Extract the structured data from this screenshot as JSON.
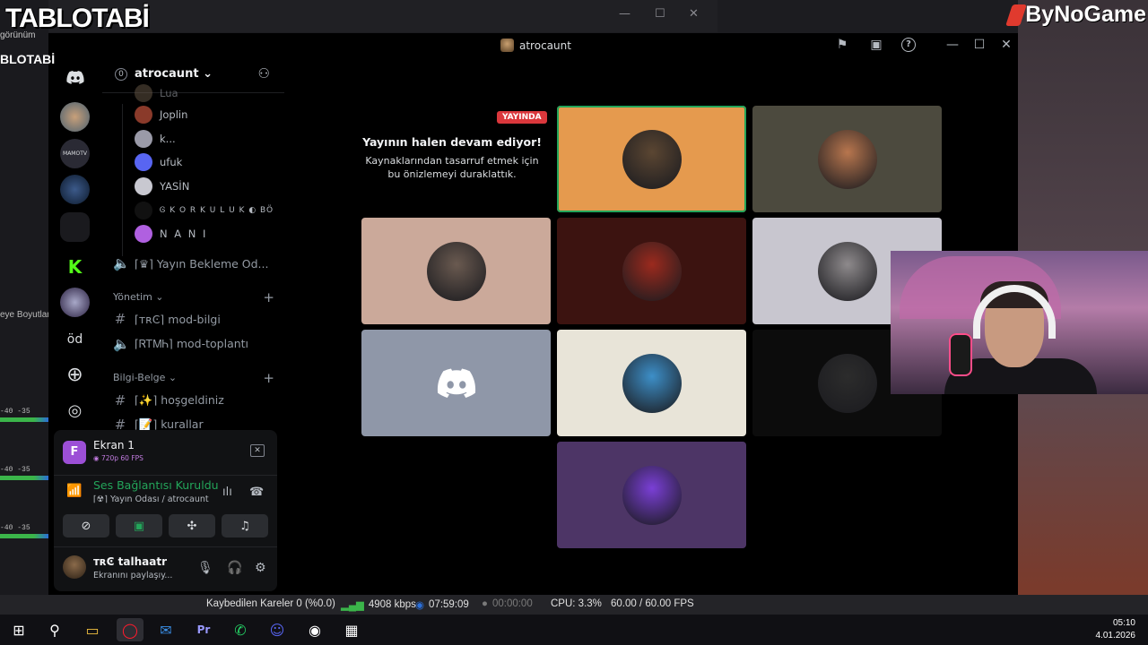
{
  "overlay": {
    "brand": "TABLOTABİ",
    "brand_small": "BLOTABİ",
    "sponsor": "ByNoGame",
    "bg_label_1": "görünüm",
    "bg_label_2": "eye Boyutlar",
    "meter_ticks": [
      "-40",
      "-35",
      "-40",
      "-35",
      "-40",
      "-35"
    ]
  },
  "window": {
    "title": "atrocaunt",
    "controls": {
      "flag": "⚑",
      "inbox": "▣",
      "help": "?",
      "minimize": "—",
      "maximize": "☐",
      "close": "✕"
    }
  },
  "rail": {
    "items": [
      {
        "label": "",
        "icon": "discord-icon"
      },
      {
        "label": "",
        "icon": "server-avatar"
      },
      {
        "label": "",
        "icon": "server-avatar"
      },
      {
        "label": "",
        "icon": "server-avatar"
      },
      {
        "label": "",
        "icon": "server-folder"
      },
      {
        "label": "",
        "icon": "kick-icon"
      },
      {
        "label": "",
        "icon": "server-avatar"
      },
      {
        "label": "öd",
        "icon": "text-server"
      },
      {
        "label": "",
        "icon": "add-server-icon"
      },
      {
        "label": "",
        "icon": "explore-icon"
      }
    ]
  },
  "sidebar": {
    "server_badge": "0",
    "server_name": "atrocaunt",
    "members": [
      {
        "name": "Lua"
      },
      {
        "name": "Joplin"
      },
      {
        "name": "k..."
      },
      {
        "name": "ufuk"
      },
      {
        "name": "YASİN"
      },
      {
        "name": "Ꮆ K O R K U L U K ◐ BÖ"
      },
      {
        "name": "N A N I"
      }
    ],
    "channels": {
      "waiting": "⌈♛⌉ Yayın Bekleme Od...",
      "cat_yonetim": "Yönetim",
      "mod_bilgi": "⌈ᴛʀϾ⌉ mod-bilgi",
      "mod_toplanti": "⌈ᏒᎢᎷᏂ⌉ mod-toplantı",
      "cat_bilgi": "Bilgi-Belge",
      "hosgeldiniz": "⌈✨⌉ hoşgeldiniz",
      "kurallar": "⌈📝⌉ kurallar"
    }
  },
  "stream_panel": {
    "avatar_letter": "F",
    "title": "Ekran 1",
    "quality": "720p 60 FPS"
  },
  "voice_panel": {
    "title": "Ses Bağlantısı Kuruldu",
    "subtitle": "⌈☢⌉ Yayın Odası / atrocaunt"
  },
  "user_panel": {
    "name": "ᴛʀϾ talhaatr",
    "status": "Ekranını paylaşıy..."
  },
  "stage": {
    "live_badge": "YAYINDA",
    "paused_title": "Yayının halen devam ediyor!",
    "paused_text": "Kaynaklarından tasarruf etmek için bu önizlemeyi duraklattık.",
    "tiles": [
      {
        "bg": "#e59a4e",
        "speaking": true,
        "avatar": "#5b4632"
      },
      {
        "bg": "#4c4a3e",
        "speaking": false,
        "avatar": "#b8764e"
      },
      {
        "bg": "#cba99a",
        "speaking": false,
        "avatar": "#6a5a50"
      },
      {
        "bg": "#3c1310",
        "speaking": false,
        "avatar": "#9b2a1e"
      },
      {
        "bg": "#c8c6cf",
        "speaking": false,
        "avatar": "#8e8a8c"
      },
      {
        "bg": "#8f97a8",
        "speaking": false,
        "avatar": "discord"
      },
      {
        "bg": "#e8e4d8",
        "speaking": false,
        "avatar": "#3d8fc8"
      },
      {
        "bg": "#0c0c0c",
        "speaking": false,
        "avatar": "#2c2c2c"
      },
      {
        "bg": "#4d3566",
        "speaking": false,
        "avatar": "#7a3fd6"
      }
    ]
  },
  "obs_stats": {
    "dropped": "Kaybedilen Kareler 0 (%0.0)",
    "bitrate": "4908 kbps",
    "stream_time": "07:59:09",
    "record_time": "00:00:00",
    "cpu": "CPU: 3.3%",
    "fps": "60.00 / 60.00 FPS"
  },
  "taskbar": {
    "time": "05:10",
    "date": "4.01.2026",
    "apps": [
      {
        "glyph": "⊞",
        "name": "start"
      },
      {
        "glyph": "⚲",
        "name": "search"
      },
      {
        "glyph": "▭",
        "name": "file-explorer"
      },
      {
        "glyph": "◯",
        "name": "opera"
      },
      {
        "glyph": "✉",
        "name": "mail"
      },
      {
        "glyph": "Pr",
        "name": "premiere"
      },
      {
        "glyph": "✆",
        "name": "whatsapp"
      },
      {
        "glyph": "☺",
        "name": "discord"
      },
      {
        "glyph": "◉",
        "name": "obs"
      },
      {
        "glyph": "▦",
        "name": "task-view"
      }
    ]
  },
  "colors": {
    "accent_green": "#23a55a",
    "live_red": "#da373c",
    "stream_purple": "#9c4fd6"
  }
}
